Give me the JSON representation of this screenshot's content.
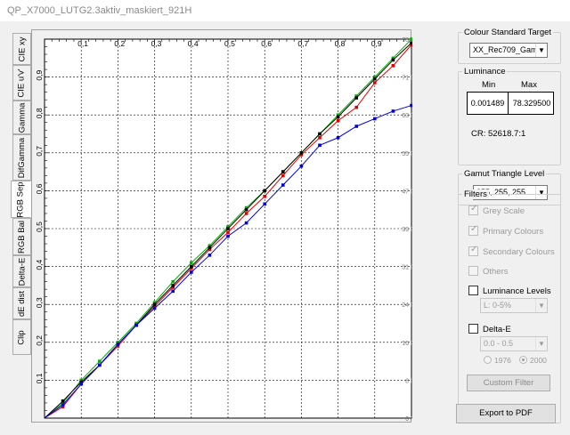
{
  "window": {
    "title": "QP_X7000_LUTG2.3aktiv_maskiert_921H"
  },
  "tabs": [
    {
      "label": "CIE xy",
      "active": false
    },
    {
      "label": "CIE u'v'",
      "active": false
    },
    {
      "label": "Gamma",
      "active": false
    },
    {
      "label": "DifGamma",
      "active": false
    },
    {
      "label": "RGB Sep",
      "active": true
    },
    {
      "label": "RGB Bal",
      "active": false
    },
    {
      "label": "Delta-E",
      "active": false
    },
    {
      "label": "dE dist",
      "active": false
    },
    {
      "label": "Clip",
      "active": false
    }
  ],
  "luminance_bar": {
    "labels": [
      "78 Nits",
      "71 Nits",
      "63 Nits",
      "55 Nits",
      "47 Nits",
      "39 Nits",
      "31 Nits",
      "24 Nits",
      "16 Nits",
      "8 Nits",
      "0 Nits"
    ],
    "fill_color": "#e8d8d8"
  },
  "chart_data": {
    "type": "line",
    "xlim": [
      0,
      1
    ],
    "ylim": [
      0,
      1
    ],
    "x_ticks": [
      "0,1",
      "0,2",
      "0,3",
      "0,4",
      "0,5",
      "0,6",
      "0,7",
      "0,8",
      "0,9"
    ],
    "y_ticks": [
      "0,1",
      "0,2",
      "0,3",
      "0,4",
      "0,5",
      "0,6",
      "0,7",
      "0,8",
      "0,9"
    ],
    "grid": true,
    "series": [
      {
        "color": "#e00000",
        "x": [
          0,
          0.05,
          0.1,
          0.15,
          0.2,
          0.25,
          0.3,
          0.35,
          0.4,
          0.45,
          0.5,
          0.55,
          0.6,
          0.65,
          0.7,
          0.75,
          0.8,
          0.85,
          0.9,
          0.95,
          1.0
        ],
        "y": [
          0,
          0.03,
          0.09,
          0.14,
          0.19,
          0.245,
          0.295,
          0.345,
          0.395,
          0.445,
          0.49,
          0.54,
          0.585,
          0.64,
          0.695,
          0.74,
          0.785,
          0.82,
          0.885,
          0.93,
          0.985
        ]
      },
      {
        "color": "#00b000",
        "x": [
          0,
          0.05,
          0.1,
          0.15,
          0.2,
          0.25,
          0.3,
          0.35,
          0.4,
          0.45,
          0.5,
          0.55,
          0.6,
          0.65,
          0.7,
          0.75,
          0.8,
          0.85,
          0.9,
          0.95,
          1.0
        ],
        "y": [
          0,
          0.04,
          0.1,
          0.15,
          0.2,
          0.25,
          0.305,
          0.36,
          0.41,
          0.455,
          0.505,
          0.555,
          0.6,
          0.65,
          0.7,
          0.75,
          0.8,
          0.85,
          0.9,
          0.95,
          1.0
        ]
      },
      {
        "color": "#000000",
        "x": [
          0,
          0.05,
          0.1,
          0.15,
          0.2,
          0.25,
          0.3,
          0.35,
          0.4,
          0.45,
          0.5,
          0.55,
          0.6,
          0.65,
          0.7,
          0.75,
          0.8,
          0.85,
          0.9,
          0.95,
          1.0
        ],
        "y": [
          0,
          0.045,
          0.095,
          0.14,
          0.195,
          0.245,
          0.3,
          0.35,
          0.4,
          0.45,
          0.5,
          0.55,
          0.6,
          0.65,
          0.7,
          0.75,
          0.795,
          0.845,
          0.895,
          0.945,
          0.99
        ]
      },
      {
        "color": "#0000e0",
        "x": [
          0,
          0.05,
          0.1,
          0.15,
          0.2,
          0.25,
          0.3,
          0.35,
          0.4,
          0.45,
          0.5,
          0.55,
          0.6,
          0.65,
          0.7,
          0.75,
          0.8,
          0.85,
          0.9,
          0.95,
          1.0
        ],
        "y": [
          0,
          0.035,
          0.09,
          0.14,
          0.195,
          0.245,
          0.29,
          0.335,
          0.385,
          0.43,
          0.48,
          0.515,
          0.565,
          0.615,
          0.665,
          0.72,
          0.74,
          0.77,
          0.79,
          0.81,
          0.825
        ]
      }
    ]
  },
  "right_panel": {
    "colour_standard": {
      "title": "Colour Standard Target",
      "value": "XX_Rec709_Gam"
    },
    "luminance": {
      "title": "Luminance",
      "min_label": "Min",
      "max_label": "Max",
      "min_value": "0.001489",
      "max_value": "78.329500",
      "cr_label": "CR: 52618.7:1"
    },
    "gamut": {
      "title": "Gamut Triangle Level",
      "value": "255, 255, 255"
    },
    "filters": {
      "title": "Filters",
      "grey_scale": "Grey Scale",
      "primary_colours": "Primary Colours",
      "secondary_colours": "Secondary Colours",
      "others": "Others",
      "luminance_levels": "Luminance Levels",
      "luminance_levels_value": "L:  0-5%",
      "delta_e": "Delta-E",
      "delta_e_value": "0.0 - 0.5",
      "radio_1976": "1976",
      "radio_2000": "2000",
      "custom_filter": "Custom Filter"
    },
    "export_button": "Export to PDF"
  }
}
